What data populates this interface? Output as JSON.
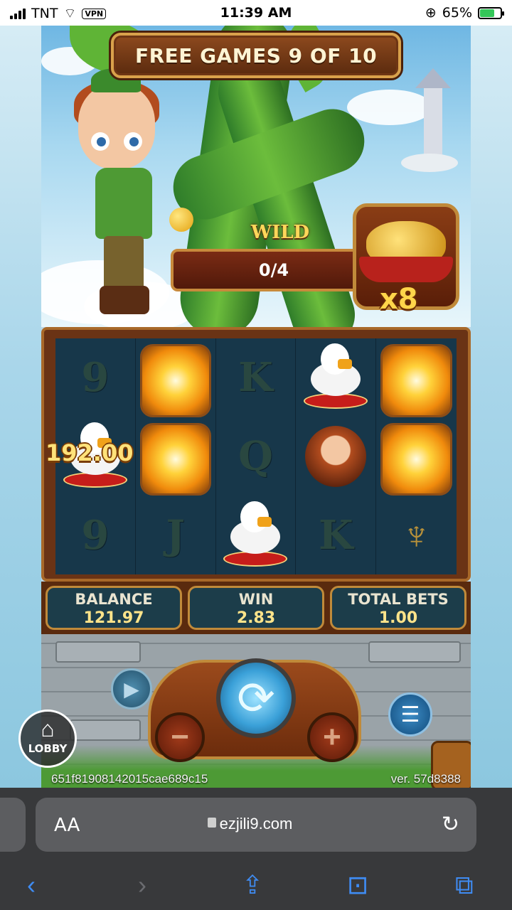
{
  "status_bar": {
    "carrier": "TNT",
    "vpn": "VPN",
    "time": "11:39 AM",
    "battery": "65%"
  },
  "game": {
    "free_games": "FREE GAMES 9 OF 10",
    "wild_label": "WILD",
    "wild_progress": "0/4",
    "multiplier": "x8",
    "win_popup": "192.00",
    "reels": [
      [
        "9",
        "glow",
        "K",
        "goose",
        "glow"
      ],
      [
        "goose",
        "glow",
        "Q",
        "boy",
        "glow"
      ],
      [
        "9",
        "J",
        "goose",
        "K",
        "lyre"
      ]
    ],
    "balance_label": "BALANCE",
    "balance_value": "121.97",
    "win_label": "WIN",
    "win_value": "2.83",
    "total_bets_label": "TOTAL BETS",
    "total_bets_value": "1.00",
    "lobby_label": "LOBBY",
    "session_id": "651f81908142015cae689c15",
    "version": "ver. 57d8388"
  },
  "browser": {
    "text_size": "AA",
    "url": "ezjili9.com"
  },
  "colors": {
    "accent_gold": "#ffd54a",
    "frame_brown": "#5a2a0e",
    "reel_bg": "#17374a",
    "browser_bg": "#38393b",
    "link_blue": "#3f8cf3"
  }
}
